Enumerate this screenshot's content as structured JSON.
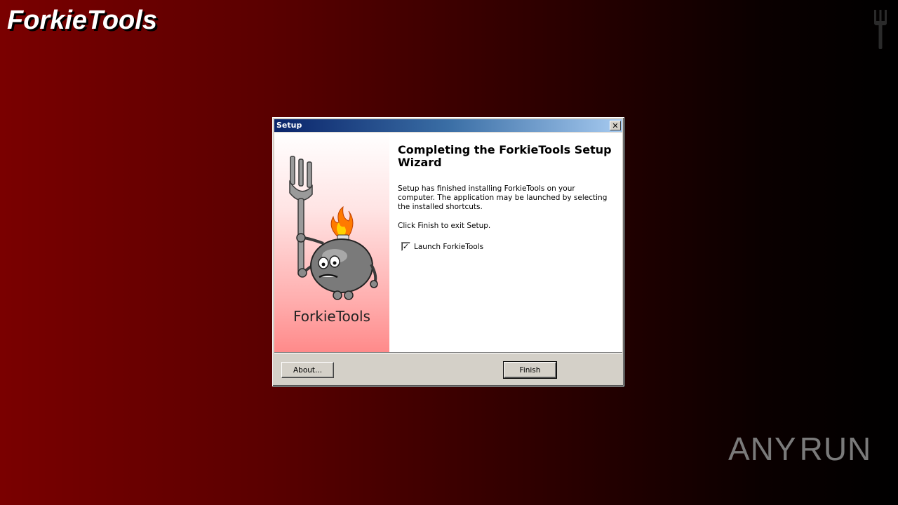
{
  "desktop": {
    "brand_title": "ForkieTools",
    "watermark": {
      "left": "ANY",
      "right": "RUN"
    }
  },
  "dialog": {
    "title": "Setup",
    "close_label": "✕",
    "side_brand": "ForkieTools",
    "heading": "Completing the ForkieTools Setup Wizard",
    "body": "Setup has finished installing ForkieTools on your computer. The application may be launched by selecting the installed shortcuts.",
    "exit_hint": "Click Finish to exit Setup.",
    "launch_checkbox": {
      "label": "Launch ForkieTools",
      "checked": true,
      "mark": "✓"
    },
    "buttons": {
      "about": "About...",
      "finish": "Finish"
    }
  },
  "colors": {
    "titlebar_start": "#0a246a",
    "titlebar_end": "#a6caf0",
    "dialog_face": "#d4d0c8",
    "desktop_red": "#7a0000"
  },
  "icons": {
    "corner": "fork-icon",
    "mascot": "fork-mascot-icon",
    "watermark": "play-icon"
  }
}
